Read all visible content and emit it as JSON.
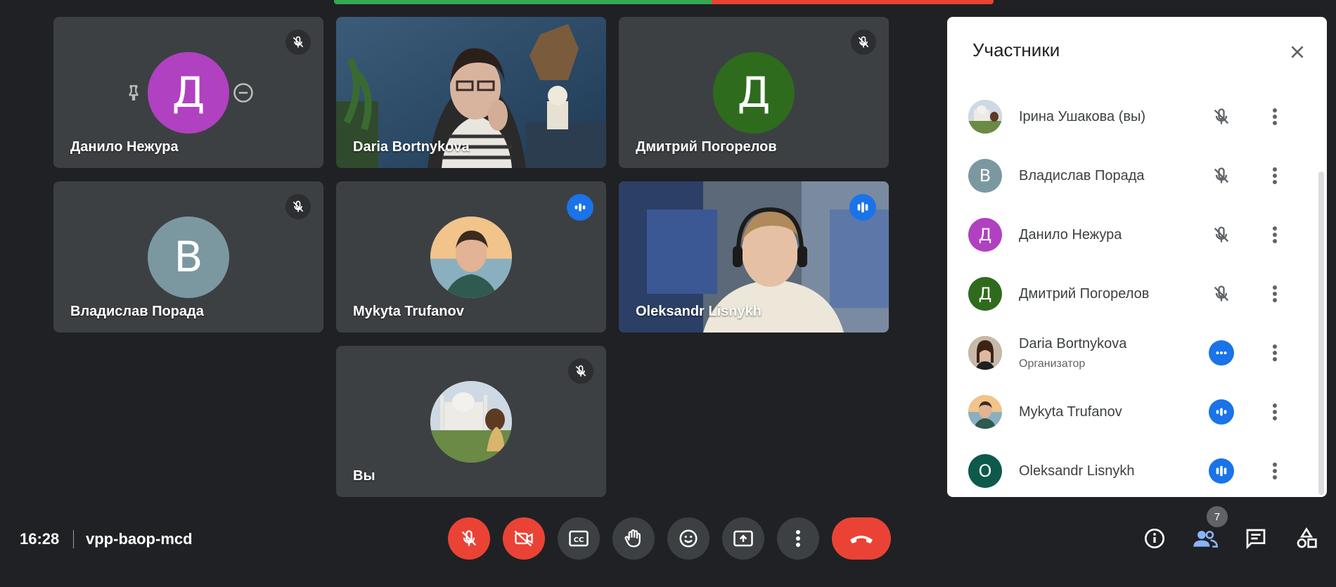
{
  "tiles": [
    {
      "name": "Данило Нежура",
      "initial": "Д",
      "color": "#b041c1"
    },
    {
      "name": "Daria Bortnykova"
    },
    {
      "name": "Дмитрий Погорелов",
      "initial": "Д",
      "color": "#2e6b1d"
    },
    {
      "name": "Владислав Порада",
      "initial": "В",
      "color": "#7b98a1"
    },
    {
      "name": "Mykyta Trufanov"
    },
    {
      "name": "Oleksandr Lisnykh"
    },
    {
      "name": "Вы"
    }
  ],
  "participants_panel": {
    "title": "Участники",
    "items": [
      {
        "name": "Ірина Ушакова (вы)",
        "mic": "muted"
      },
      {
        "name": "Владислав Порада",
        "initial": "В",
        "color": "#7b98a1",
        "mic": "muted"
      },
      {
        "name": "Данило Нежура",
        "initial": "Д",
        "color": "#b041c1",
        "mic": "muted"
      },
      {
        "name": "Дмитрий Погорелов",
        "initial": "Д",
        "color": "#2e6b1d",
        "mic": "muted"
      },
      {
        "name": "Daria Bortnykova",
        "role": "Организатор",
        "mic": "idle"
      },
      {
        "name": "Mykyta Trufanov",
        "mic": "speaking"
      },
      {
        "name": "Oleksandr Lisnykh",
        "initial": "O",
        "color": "#0e5a4a",
        "mic": "speaking"
      }
    ]
  },
  "bottom_bar": {
    "time": "16:28",
    "meeting_code": "vpp-baop-mcd",
    "participant_count": "7"
  },
  "colors": {
    "background": "#202124",
    "tile": "#3c4043",
    "danger": "#ea4335",
    "accent": "#1a73e8",
    "active_outline": "#8ab4f8"
  }
}
